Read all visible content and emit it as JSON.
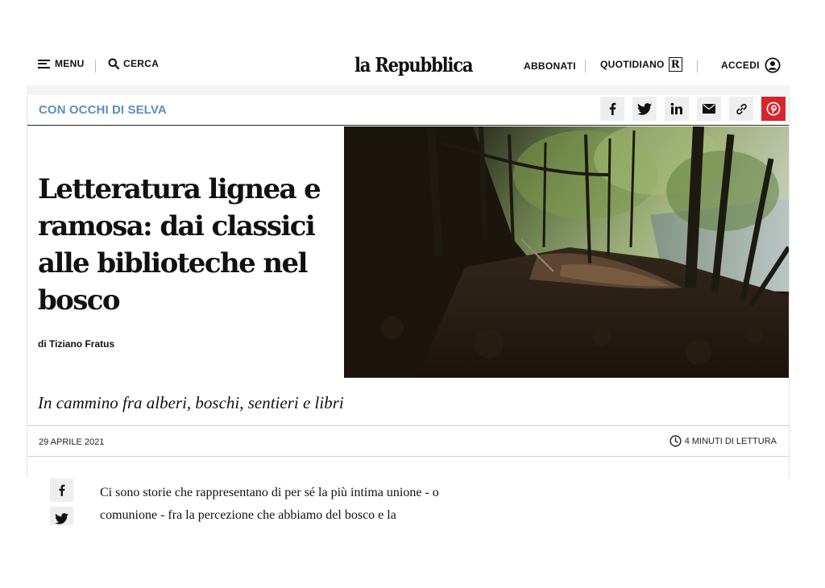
{
  "header": {
    "menu_label": "MENU",
    "search_label": "CERCA",
    "logo_text": "la Repubblica",
    "subscribe_label": "ABBONATI",
    "daily_label": "QUOTIDIANO",
    "daily_badge": "R",
    "login_label": "ACCEDI"
  },
  "article": {
    "section": "CON OCCHI DI SELVA",
    "title": "Letteratura lignea e ramosa: dai classici alle biblioteche nel bosco",
    "byline": "di Tiziano Fratus",
    "subtitle": "In cammino fra alberi, boschi, sentieri e libri",
    "date": "29 APRILE 2021",
    "reading_time": "4 MINUTI DI LETTURA",
    "body_lines": [
      "Ci sono storie che rappresentano di per sé la più intima unione - o",
      "comunione - fra la percezione che abbiamo del bosco e la"
    ]
  },
  "share_icons": [
    "facebook-icon",
    "twitter-icon",
    "linkedin-icon",
    "mail-icon",
    "link-icon",
    "pinterest-icon"
  ],
  "colors": {
    "section_accent": "#5b8fbf",
    "pinterest": "#d8242b",
    "share_bg": "#eeeeee"
  }
}
